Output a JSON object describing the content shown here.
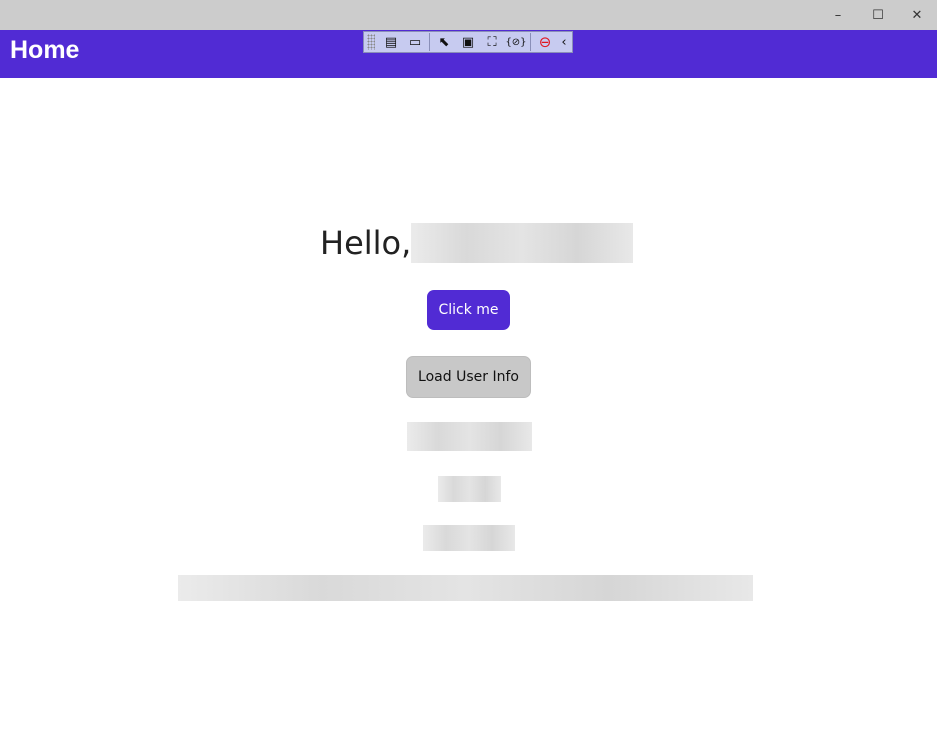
{
  "window": {
    "controls": {
      "minimize": "–",
      "maximize": "☐",
      "close": "✕"
    }
  },
  "header": {
    "title": "Home",
    "color": "#512bd4"
  },
  "debug_toolbar": {
    "icons": [
      "live-visual-tree-icon",
      "record-icon",
      "select-element-icon",
      "display-layout-adorners-icon",
      "track-focus-icon",
      "binding-failures-icon",
      "hot-reload-stop-icon",
      "collapse-icon"
    ]
  },
  "main": {
    "greeting": "Hello,",
    "click_button": "Click me",
    "load_button": "Load User Info"
  }
}
